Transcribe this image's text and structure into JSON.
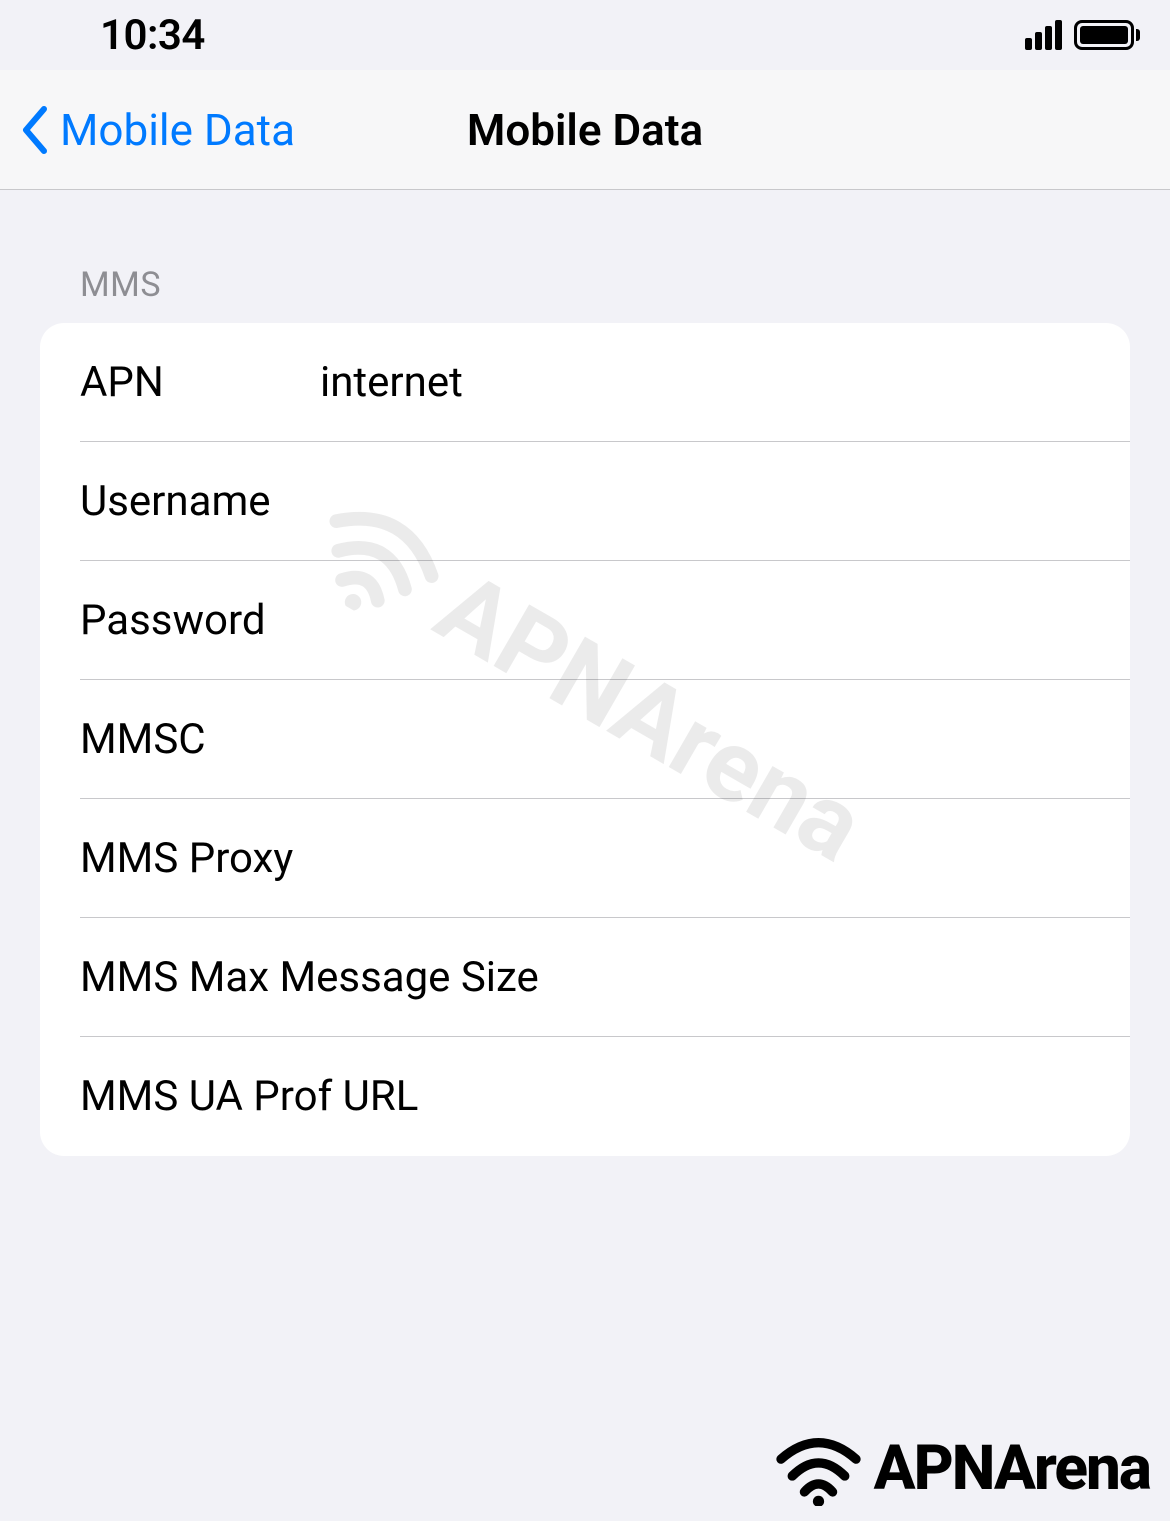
{
  "status_bar": {
    "time": "10:34"
  },
  "nav": {
    "back_label": "Mobile Data",
    "title": "Mobile Data"
  },
  "section": {
    "header": "MMS",
    "rows": {
      "apn": {
        "label": "APN",
        "value": "internet"
      },
      "username": {
        "label": "Username",
        "value": ""
      },
      "password": {
        "label": "Password",
        "value": ""
      },
      "mmsc": {
        "label": "MMSC",
        "value": ""
      },
      "mms_proxy": {
        "label": "MMS Proxy",
        "value": ""
      },
      "mms_max_size": {
        "label": "MMS Max Message Size",
        "value": ""
      },
      "mms_ua_prof": {
        "label": "MMS UA Prof URL",
        "value": ""
      }
    }
  },
  "watermark": {
    "text": "APNArena"
  },
  "footer": {
    "text": "APNArena"
  }
}
